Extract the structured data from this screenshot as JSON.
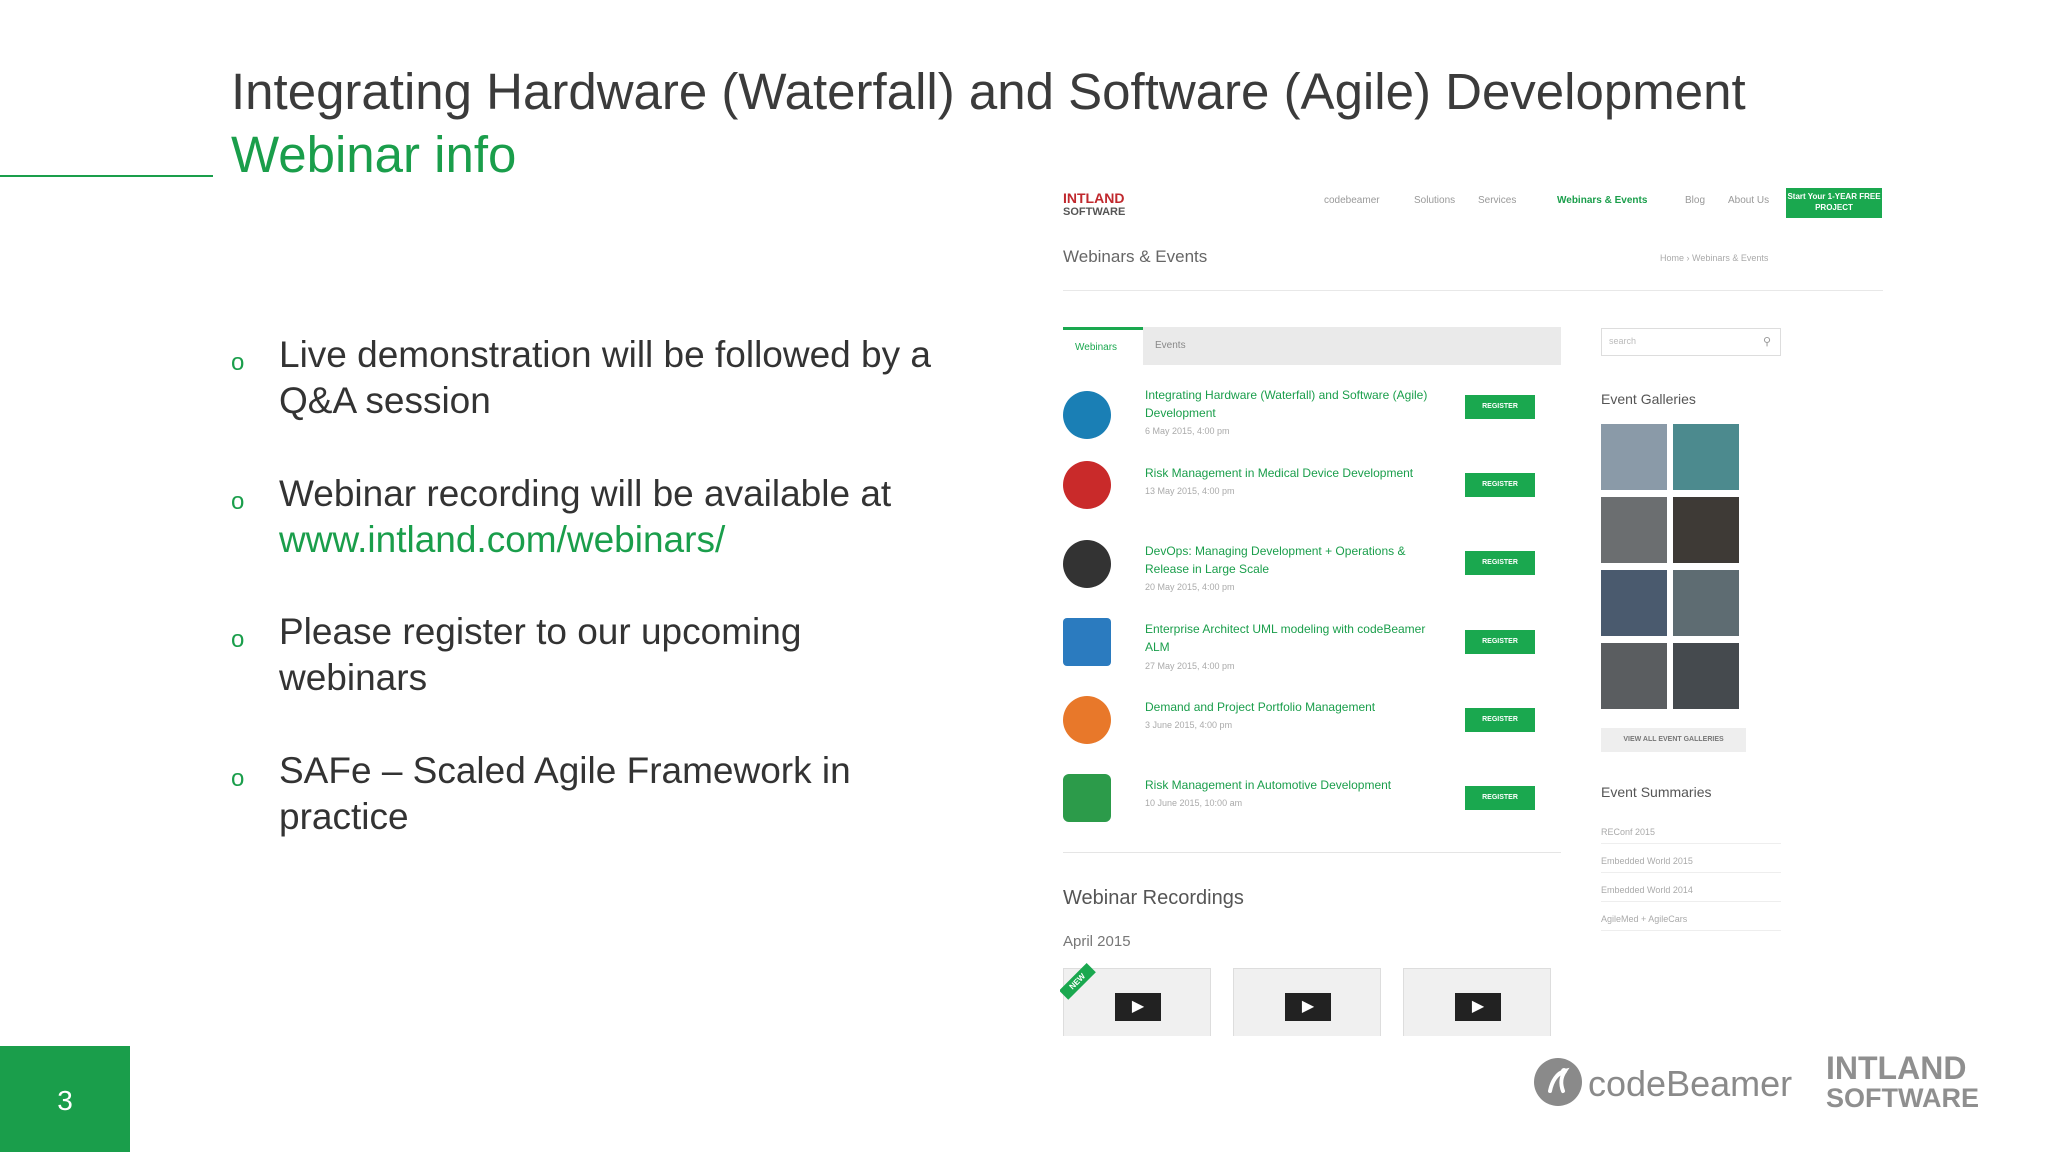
{
  "slide": {
    "title": "Integrating Hardware (Waterfall) and Software (Agile) Development",
    "subtitle": "Webinar info",
    "page_number": "3"
  },
  "bullets": [
    {
      "text": "Live demonstration will be followed by a Q&A session"
    },
    {
      "text": "Webinar recording will be available at",
      "link": "www.intland.com/webinars/"
    },
    {
      "text": "Please register to our upcoming webinars"
    },
    {
      "text": "SAFe – Scaled Agile Framework in practice"
    }
  ],
  "bullet_marker": "o",
  "footer": {
    "codebeamer_label": "codeBeamer",
    "intland_line1": "INTLAND",
    "intland_line2": "SOFTWARE"
  },
  "website": {
    "logo_line1": "INTLAND",
    "logo_line2": "SOFTWARE",
    "nav": [
      "codebeamer",
      "Solutions",
      "Services",
      "Webinars & Events",
      "Blog",
      "About Us"
    ],
    "cta": "Start Your 1-YEAR FREE PROJECT",
    "page_heading": "Webinars & Events",
    "breadcrumb": "Home  ›  Webinars & Events",
    "tabs": [
      "Webinars",
      "Events"
    ],
    "search_placeholder": "search",
    "register_label": "REGISTER",
    "events": [
      {
        "title": "Integrating Hardware (Waterfall) and Software (Agile) Development",
        "date": "6 May 2015, 4:00 pm",
        "icon_color": "#1a7fb5"
      },
      {
        "title": "Risk Management in Medical Device Development",
        "date": "13 May 2015, 4:00 pm",
        "icon_color": "#c92a2a"
      },
      {
        "title": "DevOps: Managing Development + Operations & Release in Large Scale",
        "date": "20 May 2015, 4:00 pm",
        "icon_color": "#333333"
      },
      {
        "title": "Enterprise Architect UML modeling with codeBeamer ALM",
        "date": "27 May 2015, 4:00 pm",
        "icon_color": "#2b7bbf"
      },
      {
        "title": "Demand and Project Portfolio Management",
        "date": "3 June 2015, 4:00 pm",
        "icon_color": "#e8782a"
      },
      {
        "title": "Risk Management in Automotive Development",
        "date": "10 June 2015, 10:00 am",
        "icon_color": "#2c9b4a"
      }
    ],
    "galleries_heading": "Event Galleries",
    "view_all_label": "VIEW ALL EVENT GALLERIES",
    "summaries_heading": "Event Summaries",
    "summaries": [
      "REConf 2015",
      "Embedded World 2015",
      "Embedded World 2014",
      "AgileMed + AgileCars"
    ],
    "recordings_heading": "Webinar Recordings",
    "recordings_month": "April 2015",
    "new_badge": "NEW"
  }
}
